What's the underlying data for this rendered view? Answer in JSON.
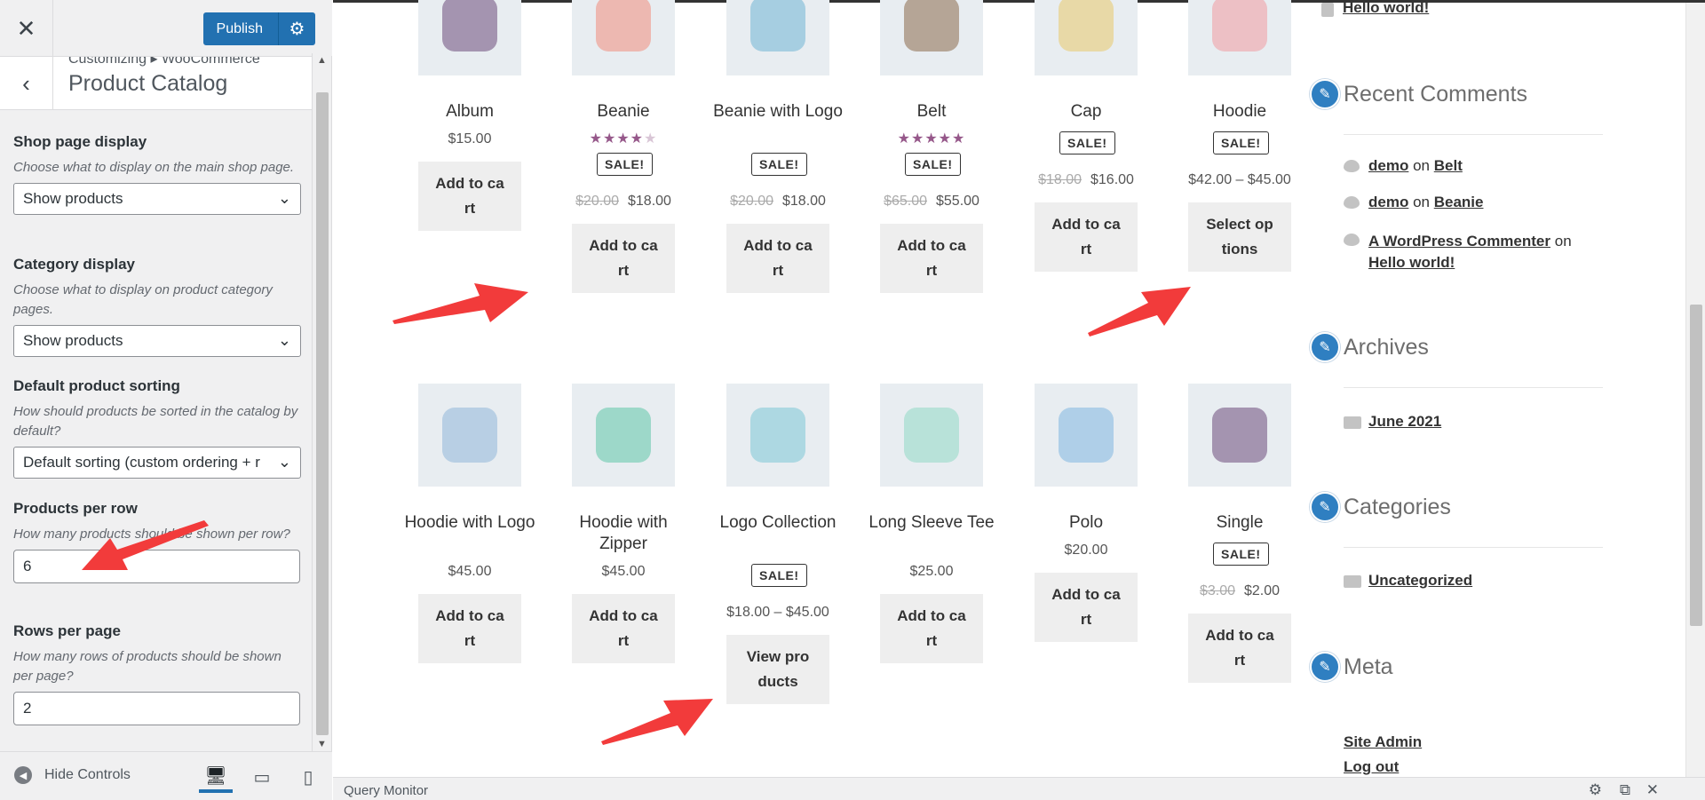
{
  "header": {
    "close_glyph": "✕",
    "publish_label": "Publish",
    "settings_icon": "gear-icon"
  },
  "section": {
    "breadcrumb": "Customizing ▸ WooCommerce",
    "title": "Product Catalog",
    "back_glyph": "‹"
  },
  "controls": {
    "shop_display": {
      "label": "Shop page display",
      "desc": "Choose what to display on the main shop page.",
      "value": "Show products"
    },
    "category_display": {
      "label": "Category display",
      "desc": "Choose what to display on product category pages.",
      "value": "Show products"
    },
    "sorting": {
      "label": "Default product sorting",
      "desc": "How should products be sorted in the catalog by default?",
      "value": "Default sorting (custom ordering + r"
    },
    "per_row": {
      "label": "Products per row",
      "desc": "How many products should be shown per row?",
      "value": "6"
    },
    "rows_per_page": {
      "label": "Rows per page",
      "desc": "How many rows of products should be shown per page?",
      "value": "2"
    }
  },
  "footer": {
    "hide_controls": "Hide Controls"
  },
  "products": [
    {
      "name": "Album",
      "price": "$15.00",
      "button": "Add to cart"
    },
    {
      "name": "Beanie",
      "stars": "★★★★★",
      "sale": "SALE!",
      "old_price": "$20.00",
      "price": "$18.00",
      "button": "Add to cart"
    },
    {
      "name": "Beanie with Logo",
      "sale": "SALE!",
      "old_price": "$20.00",
      "price": "$18.00",
      "button": "Add to cart"
    },
    {
      "name": "Belt",
      "stars": "★★★★★",
      "sale": "SALE!",
      "old_price": "$65.00",
      "price": "$55.00",
      "button": "Add to cart"
    },
    {
      "name": "Cap",
      "sale": "SALE!",
      "old_price": "$18.00",
      "price": "$16.00",
      "button": "Add to cart"
    },
    {
      "name": "Hoodie",
      "sale": "SALE!",
      "price": "$42.00 – $45.00",
      "button": "Select options"
    },
    {
      "name": "Hoodie with Logo",
      "price": "$45.00",
      "button": "Add to cart"
    },
    {
      "name": "Hoodie with Zipper",
      "price": "$45.00",
      "button": "Add to cart"
    },
    {
      "name": "Logo Collection",
      "sale": "SALE!",
      "price": "$18.00 – $45.00",
      "button": "View products"
    },
    {
      "name": "Long Sleeve Tee",
      "price": "$25.00",
      "button": "Add to cart"
    },
    {
      "name": "Polo",
      "price": "$20.00",
      "button": "Add to cart"
    },
    {
      "name": "Single",
      "sale": "SALE!",
      "old_price": "$3.00",
      "price": "$2.00",
      "button": "Add to cart"
    }
  ],
  "widgets": {
    "top_link": "Hello world!",
    "recent_comments": {
      "title": "Recent Comments",
      "items": [
        {
          "author": "demo",
          "on": "on",
          "post": "Belt"
        },
        {
          "author": "demo",
          "on": "on",
          "post": "Beanie"
        },
        {
          "author": "A WordPress Commenter",
          "on": "on",
          "post": "Hello world!"
        }
      ]
    },
    "archives": {
      "title": "Archives",
      "items": [
        "June 2021"
      ]
    },
    "categories": {
      "title": "Categories",
      "items": [
        "Uncategorized"
      ]
    },
    "meta": {
      "title": "Meta",
      "items": [
        "Site Admin",
        "Log out"
      ]
    }
  },
  "query_monitor": {
    "label": "Query Monitor"
  }
}
